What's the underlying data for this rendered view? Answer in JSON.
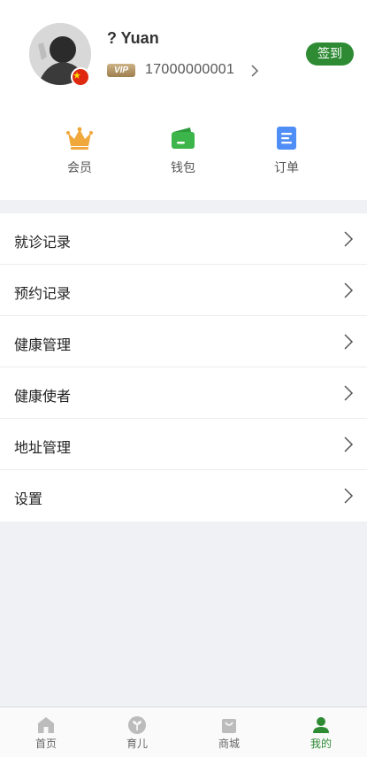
{
  "profile": {
    "username": "? Yuan",
    "vip_label": "VIP",
    "phone": "17000000001",
    "signin_label": "签到"
  },
  "quick_actions": [
    {
      "label": "会员",
      "icon": "crown-icon",
      "color": "#f0a83a"
    },
    {
      "label": "钱包",
      "icon": "wallet-icon",
      "color": "#3cb54a"
    },
    {
      "label": "订单",
      "icon": "order-icon",
      "color": "#4f8ef7"
    }
  ],
  "menu": [
    {
      "label": "就诊记录"
    },
    {
      "label": "预约记录"
    },
    {
      "label": "健康管理"
    },
    {
      "label": "健康使者"
    },
    {
      "label": "地址管理"
    },
    {
      "label": "设置"
    }
  ],
  "tabs": [
    {
      "label": "首页",
      "icon": "home-icon",
      "active": false
    },
    {
      "label": "育儿",
      "icon": "sprout-icon",
      "active": false
    },
    {
      "label": "商城",
      "icon": "shopping-bag-icon",
      "active": false
    },
    {
      "label": "我的",
      "icon": "person-icon",
      "active": true
    }
  ],
  "colors": {
    "accent": "#2e8b34",
    "background": "#eff1f5",
    "text": "#222222"
  }
}
